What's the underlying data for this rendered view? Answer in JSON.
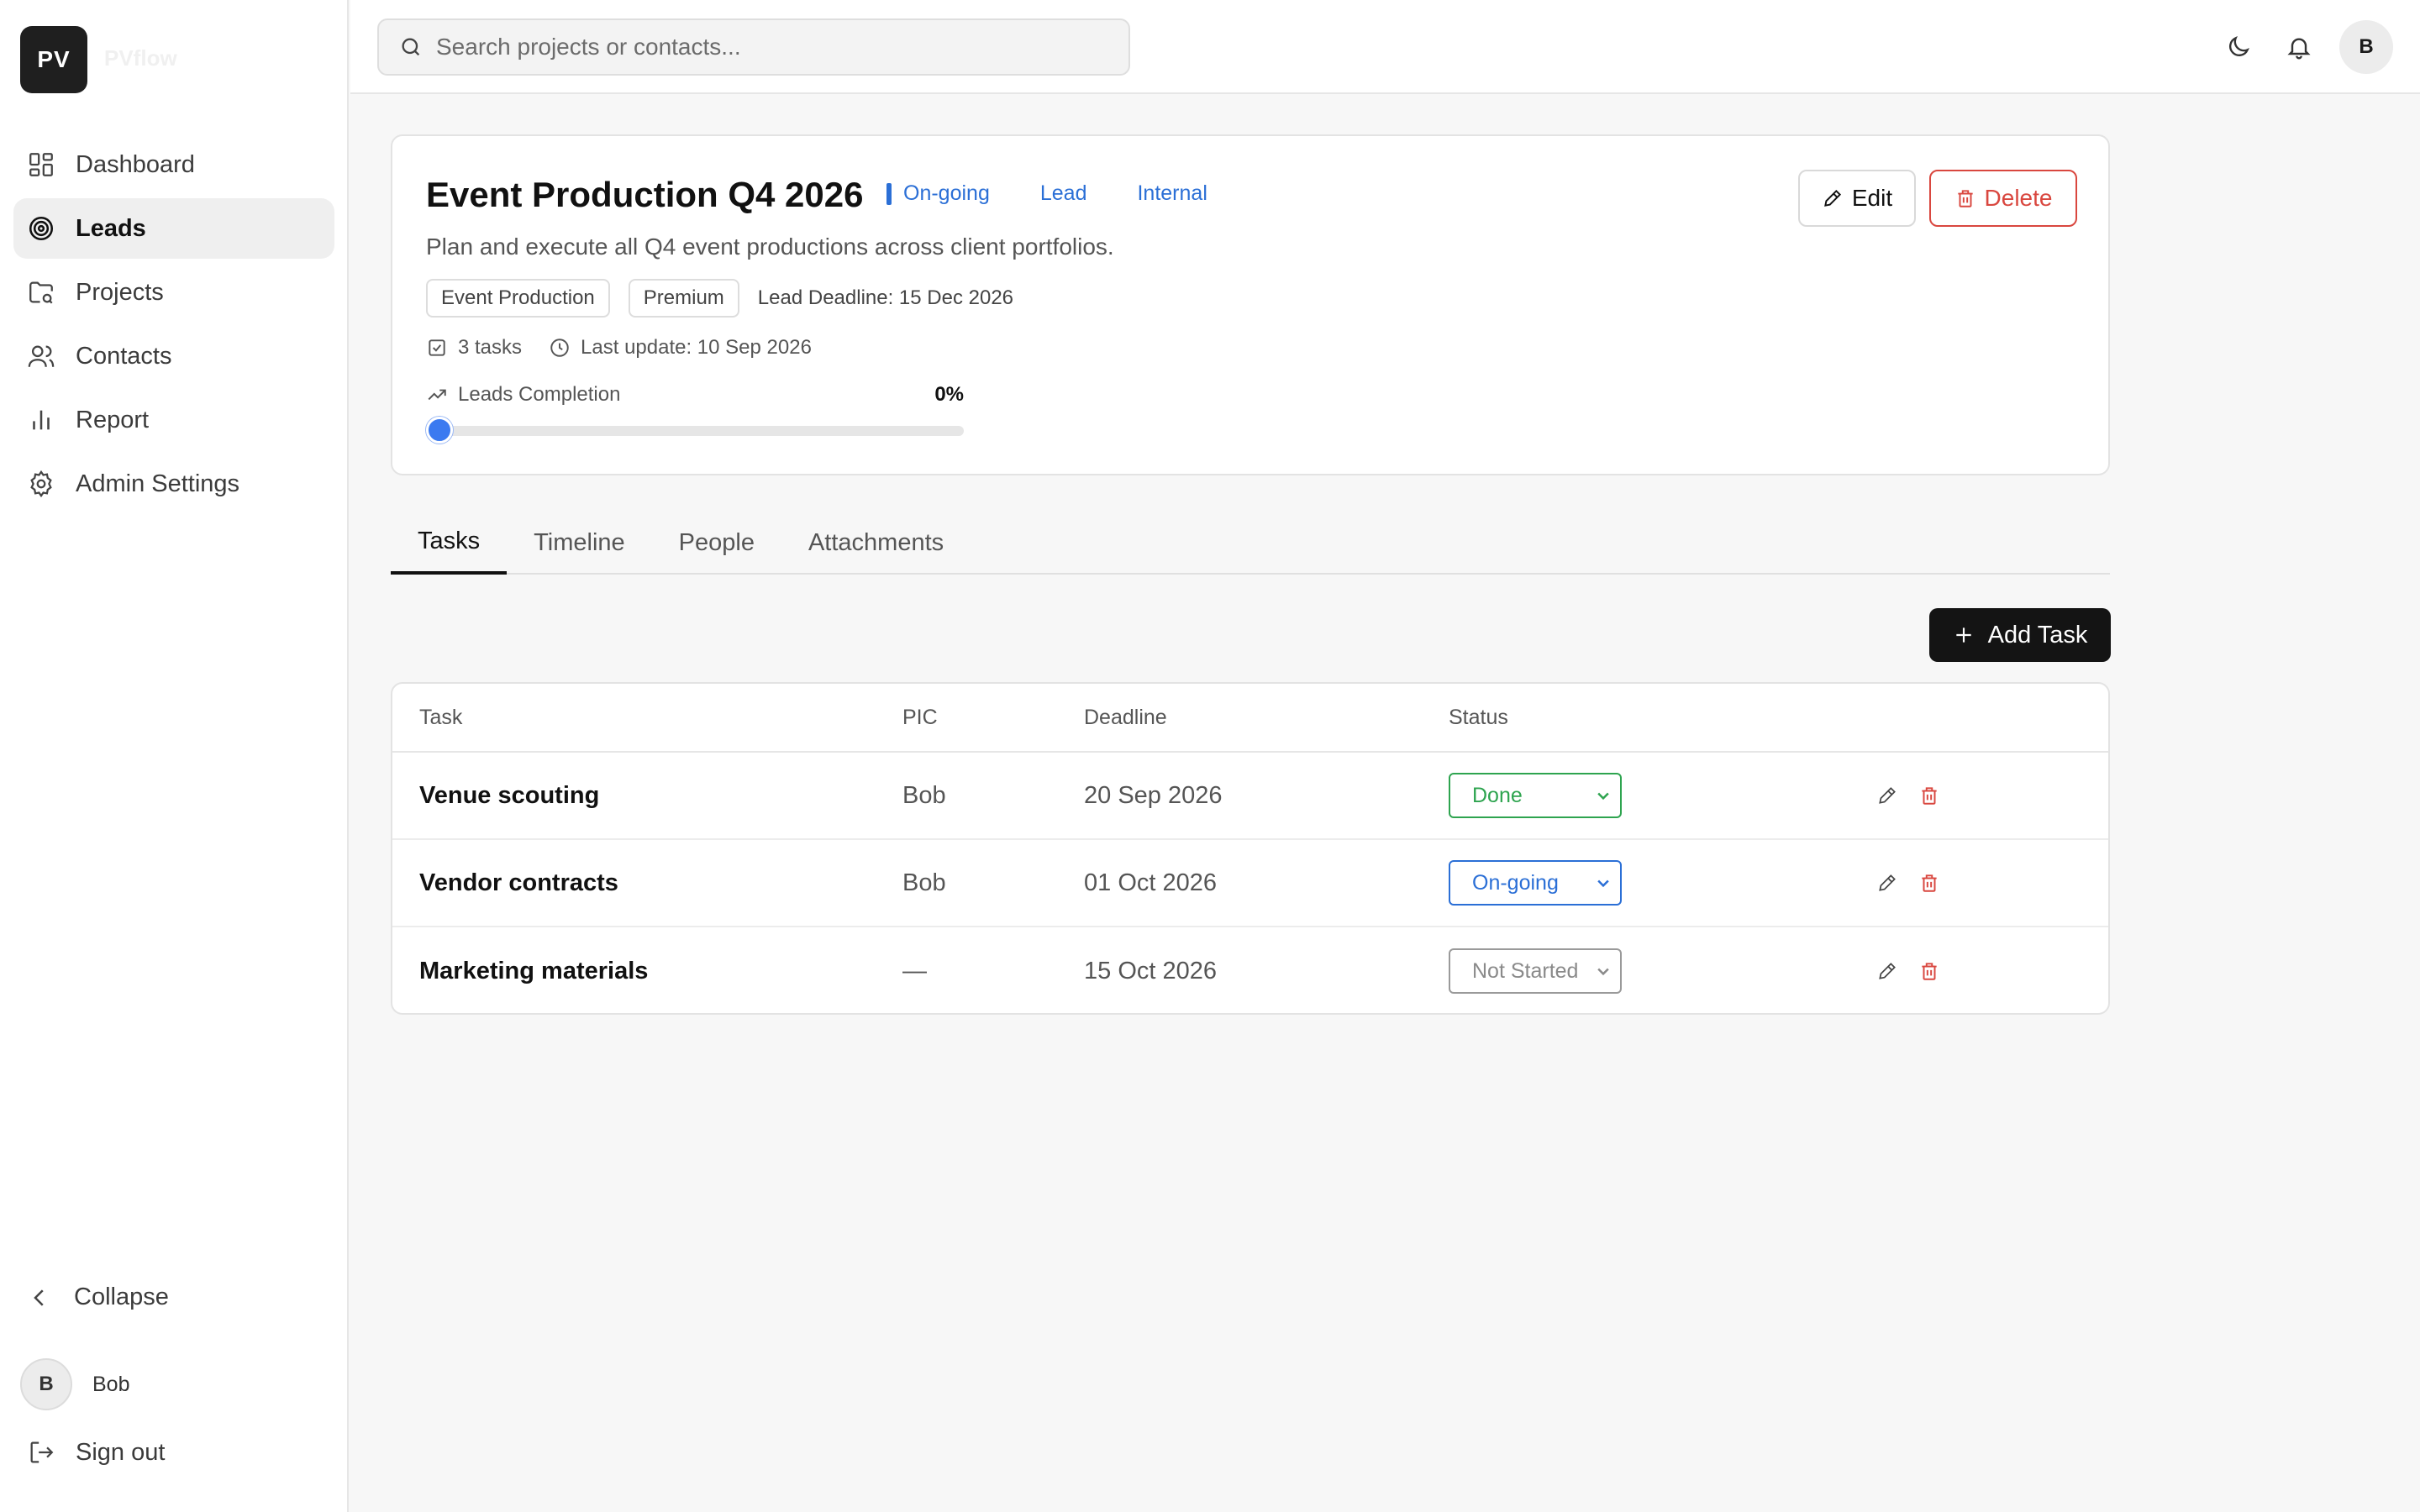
{
  "app": {
    "logo_initials": "PV",
    "brand_name": "PVflow"
  },
  "sidebar": {
    "items": [
      {
        "label": "Dashboard",
        "icon": "grid-icon"
      },
      {
        "label": "Leads",
        "icon": "target-icon",
        "active": true
      },
      {
        "label": "Projects",
        "icon": "folder-icon"
      },
      {
        "label": "Contacts",
        "icon": "users-icon"
      },
      {
        "label": "Report",
        "icon": "bar-chart-icon"
      },
      {
        "label": "Admin Settings",
        "icon": "gear-icon"
      }
    ],
    "collapse_label": "Collapse",
    "user": {
      "initial": "B",
      "name": "Bob"
    },
    "signout_label": "Sign out"
  },
  "topbar": {
    "search_placeholder": "Search projects or contacts...",
    "avatar_initial": "B"
  },
  "project": {
    "title": "Event Production Q4 2026",
    "status": "On-going",
    "type": "Lead",
    "scope": "Internal",
    "description": "Plan and execute all Q4 event productions across client portfolios.",
    "tags": [
      "Event Production",
      "Premium"
    ],
    "deadline": "Lead Deadline: 15 Dec 2026",
    "tasks_count": "3 tasks",
    "last_update": "Last update: 10 Sep 2026",
    "completion_label": "Leads Completion",
    "completion_value": 0,
    "completion_text": "0%",
    "edit_label": "Edit",
    "delete_label": "Delete"
  },
  "tabs": [
    {
      "label": "Tasks",
      "active": true
    },
    {
      "label": "Timeline"
    },
    {
      "label": "People"
    },
    {
      "label": "Attachments"
    }
  ],
  "add_task_label": "Add Task",
  "table": {
    "headers": [
      "Task",
      "PIC",
      "Deadline",
      "Status"
    ],
    "rows": [
      {
        "task": "Venue scouting",
        "pic": "Bob",
        "deadline": "20 Sep 2026",
        "status": "Done"
      },
      {
        "task": "Vendor contracts",
        "pic": "Bob",
        "deadline": "01 Oct 2026",
        "status": "On-going"
      },
      {
        "task": "Marketing materials",
        "pic": "—",
        "deadline": "15 Oct 2026",
        "status": "Not Started"
      }
    ]
  },
  "colors": {
    "accent": "#2b6fd6",
    "done": "#2ea44f",
    "danger": "#d9473f",
    "dark": "#141414"
  }
}
